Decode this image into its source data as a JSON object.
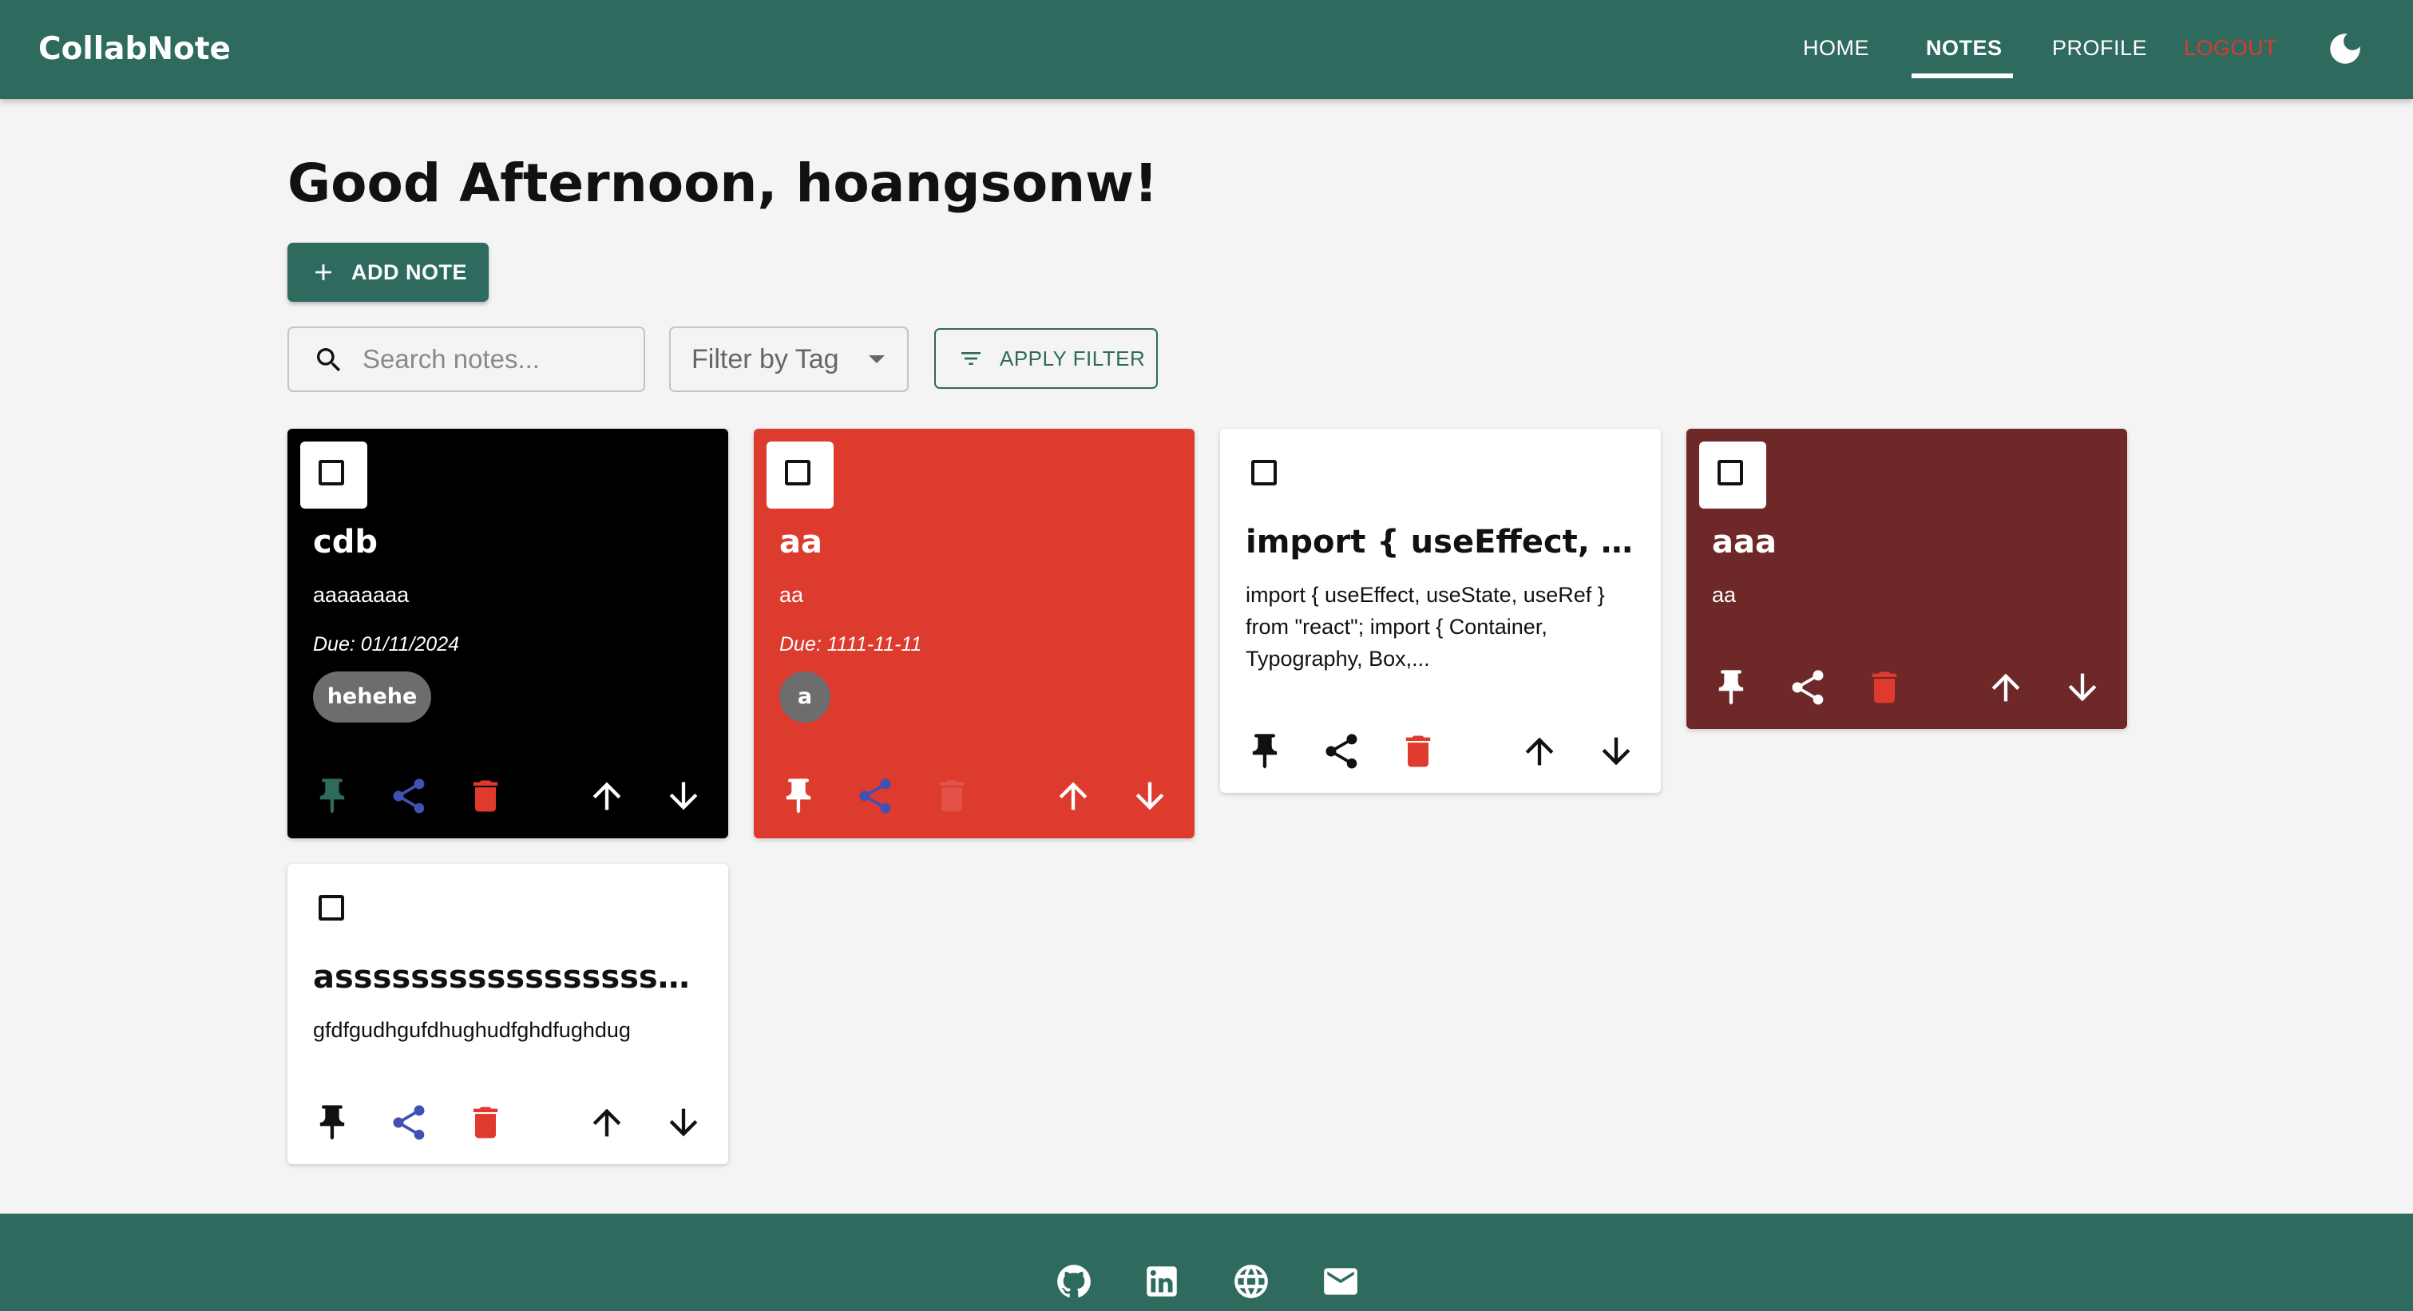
{
  "app": {
    "brand": "CollabNote"
  },
  "nav": {
    "home": "HOME",
    "notes": "NOTES",
    "profile": "PROFILE",
    "logout": "LOGOUT",
    "theme_icon": "moon-icon"
  },
  "greeting": "Good Afternoon, hoangsonw!",
  "toolbar": {
    "add_note_label": "ADD NOTE",
    "search_placeholder": "Search notes...",
    "filter_label": "Filter by Tag",
    "apply_filter_label": "APPLY FILTER"
  },
  "notes": [
    {
      "title": "cdb",
      "content": "aaaaaaaa",
      "due": "Due: 01/11/2024",
      "tag": "hehehe",
      "bg_color": "#000000",
      "text_color": "#ffffff"
    },
    {
      "title": "aa",
      "content": "aa",
      "due": "Due: 1111-11-11",
      "tag": "a",
      "bg_color": "#dd3b2e",
      "text_color": "#ffffff"
    },
    {
      "title": "import { useEffect, use...",
      "content": "import { useEffect, useState, useRef } from \"react\"; import { Container, Typography, Box,...",
      "bg_color": "#ffffff",
      "text_color": "#111111"
    },
    {
      "title": "aaa",
      "content": "aa",
      "bg_color": "#6e2828",
      "text_color": "#ffffff"
    },
    {
      "title": "assssssssssssssssss...",
      "content": "gfdfgudhgufdhughudfghdfughdug",
      "bg_color": "#ffffff",
      "text_color": "#111111"
    }
  ],
  "footer": {
    "icons": [
      "github-icon",
      "linkedin-icon",
      "globe-icon",
      "email-icon"
    ]
  },
  "colors": {
    "primary": "#2e6b5e",
    "danger": "#e0392d",
    "share": "#3f51b5",
    "background": "#f4f4f4"
  }
}
